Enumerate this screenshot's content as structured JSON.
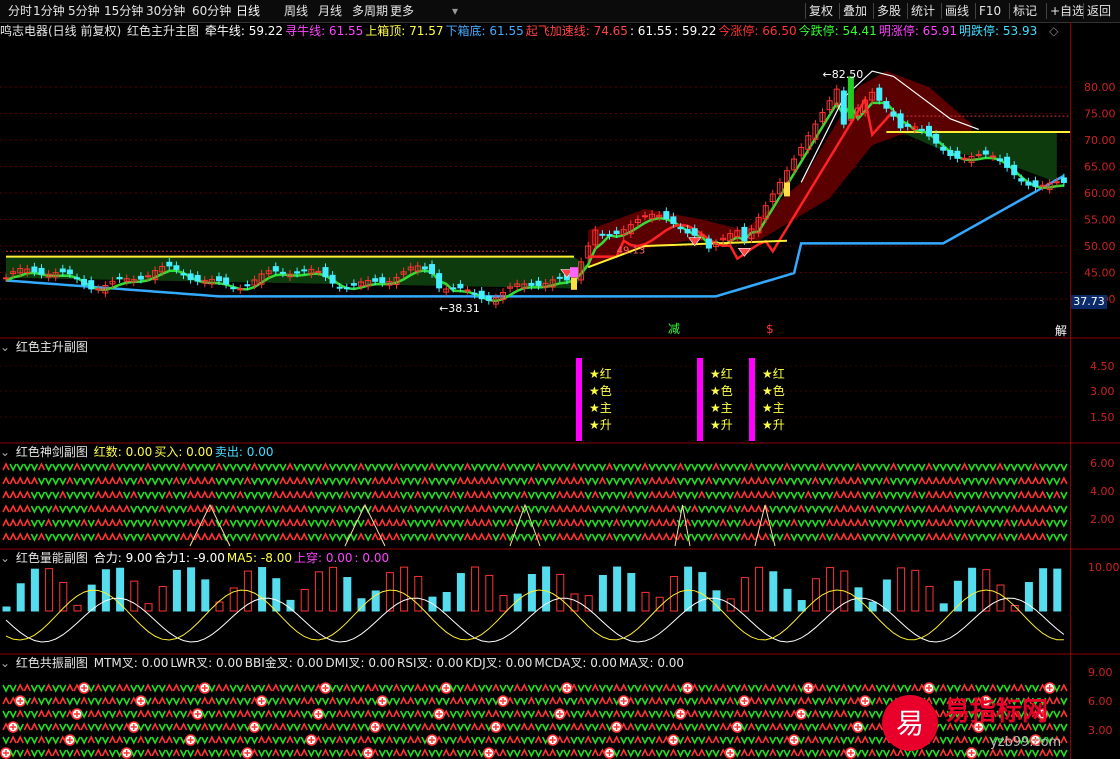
{
  "toolbar": {
    "left_items": [
      "分时",
      "1分钟",
      "5分钟",
      "15分钟",
      "30分钟",
      "60分钟",
      "日线",
      "周线",
      "月线",
      "多周期",
      "更多"
    ],
    "active": "日线",
    "right_items": [
      "复权",
      "叠加",
      "多股",
      "统计",
      "画线",
      "F10",
      "标记",
      "+自选",
      "返回"
    ]
  },
  "main_header": {
    "stock": "鸣志电器(日线 前复权)",
    "indicator": "红色主升主图",
    "items": [
      {
        "label": "牵牛线:",
        "value": "59.22",
        "color": "#ffffff"
      },
      {
        "label": "寻牛线:",
        "value": "61.55",
        "color": "#ff44ff"
      },
      {
        "label": "上箱顶:",
        "value": "71.57",
        "color": "#ffff44"
      },
      {
        "label": "下箱底:",
        "value": "61.55",
        "color": "#44aaff"
      },
      {
        "label": "起飞加速线:",
        "value": "74.65",
        "color": "#ff4444"
      },
      {
        "label": ":",
        "value": "61.55",
        "color": "#ffffff"
      },
      {
        "label": ":",
        "value": "59.22",
        "color": "#ffffff"
      },
      {
        "label": "今涨停:",
        "value": "66.50",
        "color": "#ff3333"
      },
      {
        "label": "今跌停:",
        "value": "54.41",
        "color": "#33ff33"
      },
      {
        "label": "明涨停:",
        "value": "65.91",
        "color": "#ff44ff"
      },
      {
        "label": "明跌停:",
        "value": "53.93",
        "color": "#44ddff"
      }
    ]
  },
  "main_axis": [
    "80.00",
    "75.00",
    "70.00",
    "65.00",
    "60.00",
    "55.00",
    "50.00",
    "45.00",
    "40.00"
  ],
  "price_tag": "37.73",
  "annotations": {
    "high": "82.50",
    "low": "38.31",
    "mid": "49.13",
    "mark_jian": "减",
    "mark_s": "$",
    "mark_jie": "解"
  },
  "sub1": {
    "title": "红色主升副图",
    "axis": [
      "4.50",
      "3.00",
      "1.50"
    ],
    "signal_chars": [
      "★红",
      "★色",
      "★主",
      "★升"
    ]
  },
  "sub2": {
    "title": "红色神剑副图",
    "items": [
      {
        "label": "红数:",
        "value": "0.00",
        "color": "#ffff44"
      },
      {
        "label": "买入:",
        "value": "0.00",
        "color": "#ffff44"
      },
      {
        "label": "卖出:",
        "value": "0.00",
        "color": "#44ddff"
      }
    ],
    "axis": [
      "6.00",
      "4.00",
      "2.00"
    ]
  },
  "sub3": {
    "title": "红色量能副图",
    "items": [
      {
        "label": "合力:",
        "value": "9.00",
        "color": "#ffffff"
      },
      {
        "label": "合力1:",
        "value": "-9.00",
        "color": "#ffffff"
      },
      {
        "label": "MA5:",
        "value": "-8.00",
        "color": "#ffff44"
      },
      {
        "label": "上穿:",
        "value": "0.00",
        "color": "#ff44ff"
      },
      {
        "label": ":",
        "value": "0.00",
        "color": "#ff44ff"
      }
    ],
    "axis": [
      "10.00"
    ]
  },
  "sub4": {
    "title": "红色共振副图",
    "items": [
      {
        "label": "MTM叉:",
        "value": "0.00"
      },
      {
        "label": "LWR叉:",
        "value": "0.00"
      },
      {
        "label": "BBI金叉:",
        "value": "0.00"
      },
      {
        "label": "DMI叉:",
        "value": "0.00"
      },
      {
        "label": "RSI叉:",
        "value": "0.00"
      },
      {
        "label": "KDJ叉:",
        "value": "0.00"
      },
      {
        "label": "MCDA叉:",
        "value": "0.00"
      },
      {
        "label": "MA叉:",
        "value": "0.00"
      }
    ],
    "axis": [
      "9.00",
      "6.00",
      "3.00"
    ]
  },
  "watermark": {
    "brand": "易指标网",
    "glyph": "易",
    "url": "yzb99.com"
  },
  "colors": {
    "up": "#ff3333",
    "down": "#44eeff",
    "bg": "#000000",
    "grid": "#8b0000"
  }
}
